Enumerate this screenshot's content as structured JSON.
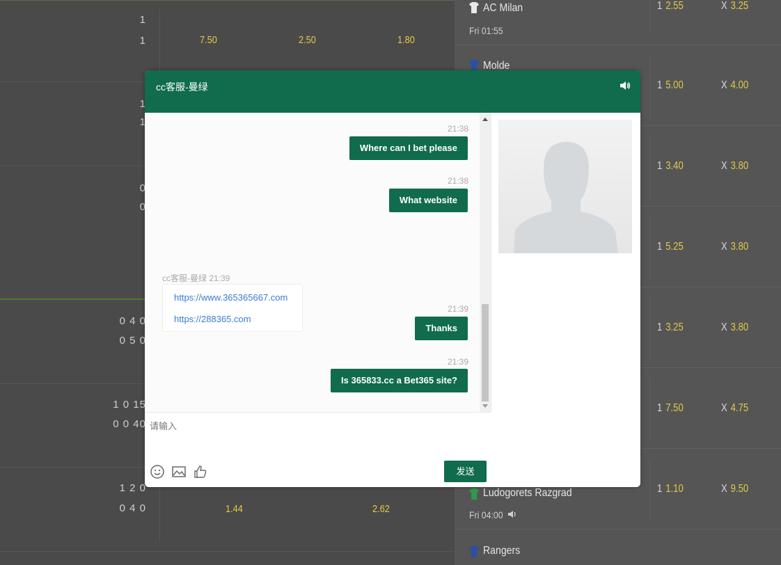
{
  "chat": {
    "title": "cc客服-曼绿",
    "messages": [
      {
        "time": "21:38",
        "text": "Where can I bet please"
      },
      {
        "time": "21:38",
        "text": "What website"
      },
      {
        "time": "21:39",
        "text": "Thanks"
      },
      {
        "time": "21:39",
        "text": "Is 365833.cc a Bet365 site?"
      }
    ],
    "agent_message": {
      "header": "cc客服-曼绿 21:39",
      "links": [
        "https://www.365365667.com",
        "https://288365.com"
      ]
    },
    "input_placeholder": "请输入",
    "send_label": "发送"
  },
  "background": {
    "left_rows": [
      {
        "scores": [
          "1",
          "1"
        ],
        "odds": [
          "7.50",
          "2.50",
          "1.80"
        ]
      },
      {
        "scores": [
          "1",
          "1"
        ],
        "odds": []
      },
      {
        "scores": [
          "0",
          "0"
        ],
        "odds": []
      },
      {
        "scores": [
          "0 4 0",
          "0 5 0"
        ],
        "odds": []
      },
      {
        "scores": [
          "1 0 15",
          "0 0 40"
        ],
        "odds": []
      },
      {
        "scores": [
          "1 2 0",
          "0 4 0"
        ],
        "odds": [
          "1.44",
          "2.62"
        ]
      }
    ],
    "matches": [
      {
        "team": "AC Milan",
        "time": "Fri 01:55",
        "odd1": "2.55",
        "oddx": "3.25"
      },
      {
        "team": "Molde",
        "time": "",
        "odd1": "5.00",
        "oddx": "4.00"
      },
      {
        "team": "",
        "time": "",
        "odd1": "3.40",
        "oddx": "3.80"
      },
      {
        "team": "",
        "time": "",
        "odd1": "5.25",
        "oddx": "3.80"
      },
      {
        "team": "",
        "time": "",
        "odd1": "3.25",
        "oddx": "3.80"
      },
      {
        "team": "",
        "time": "",
        "odd1": "7.50",
        "oddx": "4.75"
      },
      {
        "team": "Ludogorets Razgrad",
        "time": "Fri 04:00",
        "odd1": "1.10",
        "oddx": "9.50"
      },
      {
        "team": "Rangers",
        "time": "",
        "odd1": "",
        "oddx": ""
      }
    ],
    "odd1_label": "1",
    "oddx_label": "X"
  },
  "colors": {
    "brand_green": "#116b4d",
    "odds_yellow": "#e3c94a",
    "link_blue": "#3a7bd5"
  },
  "icons": [
    "speaker-icon",
    "emoji-icon",
    "image-icon",
    "thumbs-up-icon",
    "avatar-placeholder-icon",
    "shirt-icon"
  ]
}
